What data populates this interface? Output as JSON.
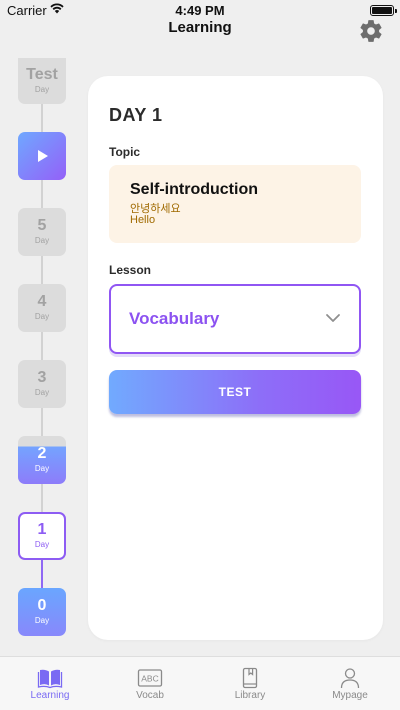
{
  "status_bar": {
    "carrier": "Carrier",
    "time": "4:49 PM"
  },
  "nav": {
    "title": "Learning",
    "settings_icon": "gear-icon"
  },
  "timeline": {
    "items": [
      {
        "label": "Test",
        "sub": "Day",
        "state": "locked"
      },
      {
        "label": "",
        "sub": "",
        "state": "current-play",
        "icon": "play-icon"
      },
      {
        "label": "5",
        "sub": "Day",
        "state": "locked"
      },
      {
        "label": "4",
        "sub": "Day",
        "state": "locked"
      },
      {
        "label": "3",
        "sub": "Day",
        "state": "locked"
      },
      {
        "label": "2",
        "sub": "Day",
        "state": "partial",
        "progress": 0.78
      },
      {
        "label": "1",
        "sub": "Day",
        "state": "selected"
      },
      {
        "label": "0",
        "sub": "Day",
        "state": "completed"
      }
    ]
  },
  "card": {
    "day_title": "DAY 1",
    "topic_label": "Topic",
    "topic": {
      "title": "Self-introduction",
      "korean": "안녕하세요",
      "english": "Hello"
    },
    "lesson_label": "Lesson",
    "lesson_value": "Vocabulary",
    "test_button": "TEST"
  },
  "tabs": [
    {
      "label": "Learning",
      "icon": "book-icon",
      "active": true
    },
    {
      "label": "Vocab",
      "icon": "abc-icon",
      "active": false
    },
    {
      "label": "Library",
      "icon": "library-book-icon",
      "active": false
    },
    {
      "label": "Mypage",
      "icon": "person-icon",
      "active": false
    }
  ],
  "colors": {
    "accent_purple": "#8c52f1",
    "accent_blue": "#71aafe",
    "topic_bg": "#fdf3e6",
    "topic_text": "#a06a00",
    "tab_active": "#7a6af3"
  }
}
